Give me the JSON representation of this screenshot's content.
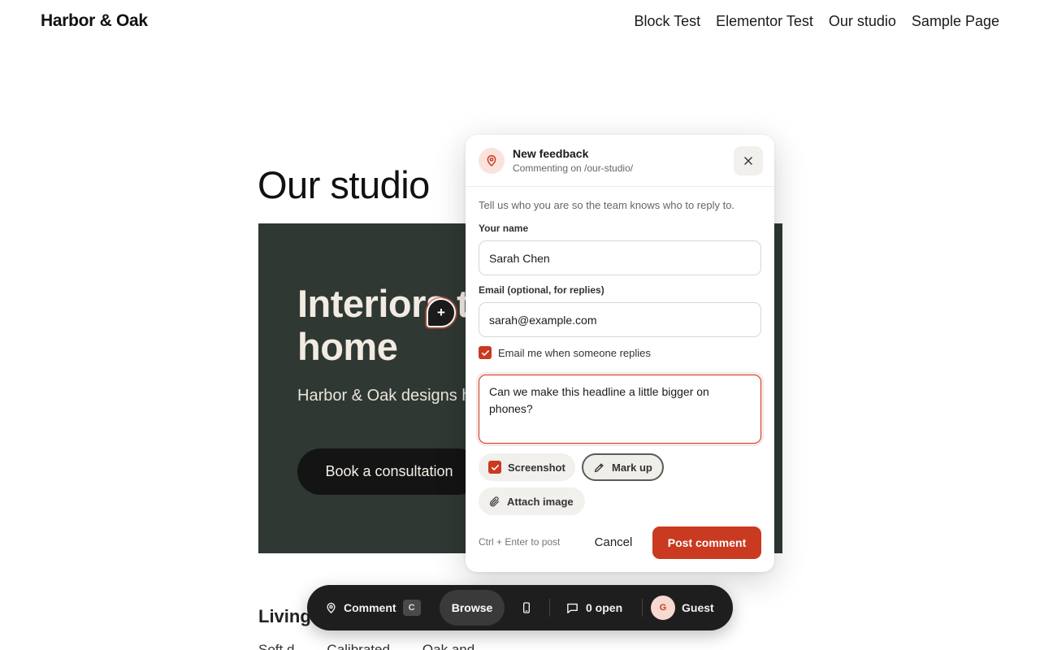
{
  "site": {
    "title": "Harbor & Oak",
    "nav": [
      "Block Test",
      "Elementor Test",
      "Our studio",
      "Sample Page"
    ]
  },
  "page": {
    "title": "Our studio",
    "hero": {
      "heading": "Interiors that feel like home",
      "subtext": "Harbor & Oak designs homes across Bristol and Bath.",
      "cta": "Book a consultation"
    },
    "section_heading": "Living r",
    "bottom_texts": [
      "Soft d",
      "Calibrated",
      "Oak and ..."
    ]
  },
  "pin": {
    "symbol": "+"
  },
  "dialog": {
    "title": "New feedback",
    "subtitle": "Commenting on /our-studio/",
    "intro": "Tell us who you are so the team knows who to reply to.",
    "name_label": "Your name",
    "name_value": "Sarah Chen",
    "email_label": "Email (optional, for replies)",
    "email_value": "sarah@example.com",
    "notify_label": "Email me when someone replies",
    "notify_checked": true,
    "comment_value": "Can we make this headline a little bigger on phones?",
    "screenshot_label": "Screenshot",
    "screenshot_checked": true,
    "markup_label": "Mark up",
    "attach_label": "Attach image",
    "hint": "Ctrl + Enter to post",
    "cancel_label": "Cancel",
    "post_label": "Post comment"
  },
  "toolbar": {
    "comment_label": "Comment",
    "comment_shortcut": "C",
    "browse_label": "Browse",
    "open_count_label": "0 open",
    "avatar_initial": "G",
    "user_label": "Guest"
  },
  "colors": {
    "accent": "#c93a20",
    "hero_bg": "#2f3832",
    "toolbar_bg": "#1e1e1e"
  }
}
